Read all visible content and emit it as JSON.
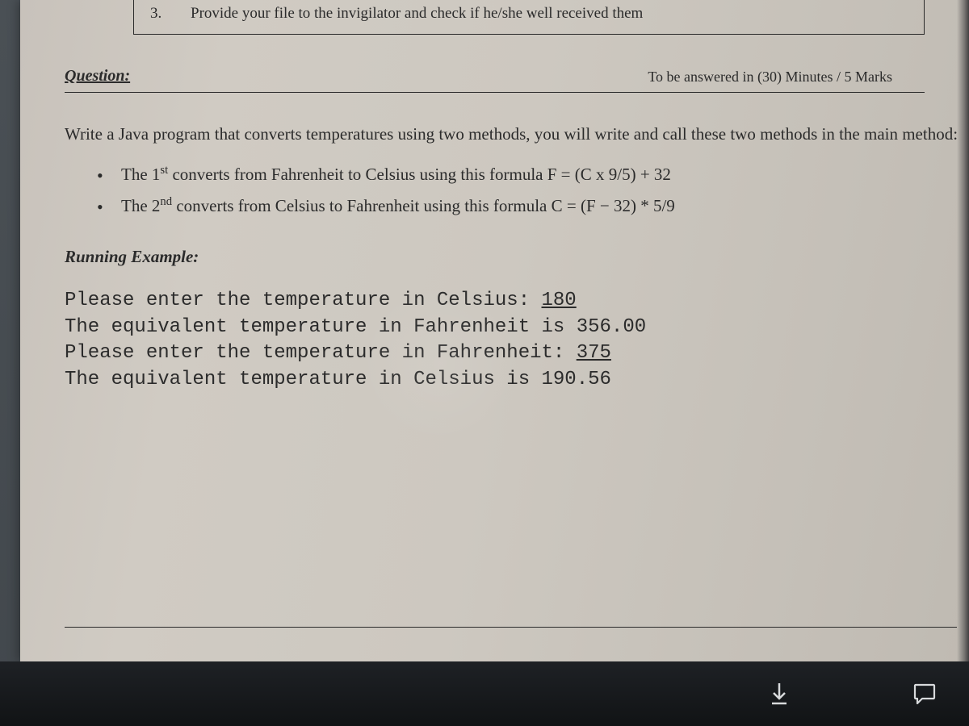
{
  "top_box": {
    "number": "3.",
    "text": "Provide your file to the invigilator and check if he/she well received them"
  },
  "question_row": {
    "label": "Question:",
    "time": "To be answered in (30) Minutes / 5 Marks"
  },
  "intro": "Write a Java program that converts temperatures using two methods, you will write and call these two methods in the main method:",
  "bullets": {
    "b1_pre": "The 1",
    "b1_sup": "st",
    "b1_post": " converts from Fahrenheit to Celsius using this formula F  =  (C x 9/5)  +  32",
    "b2_pre": "The 2",
    "b2_sup": "nd",
    "b2_post": " converts from Celsius to Fahrenheit using this formula  C  =  (F  −  32)  *  5/9"
  },
  "running_label": "Running Example:",
  "code": {
    "l1a": "Please enter the temperature in Celsius: ",
    "l1u": "180",
    "l2": "The equivalent temperature in Fahrenheit is 356.00",
    "l3a": "Please enter the temperature in Fahrenheit: ",
    "l3u": "375",
    "l4": "The equivalent temperature in Celsius is 190.56"
  }
}
